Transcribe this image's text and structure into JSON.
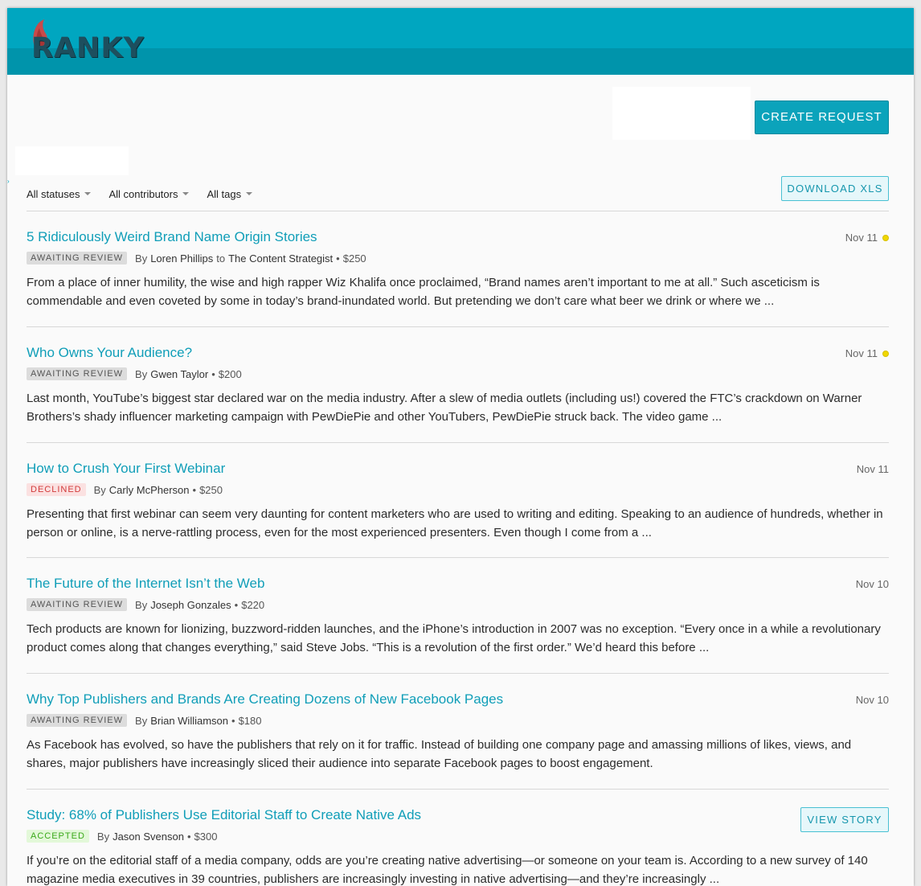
{
  "app": {
    "name": "RANKY",
    "colors": {
      "accent": "#00a6c0",
      "title_link": "#109eb8",
      "pending_dot": "#f0d700"
    }
  },
  "toolbar": {
    "create_label": "CREATE REQUEST",
    "download_label": "DOWNLOAD XLS"
  },
  "filters": [
    {
      "label": "All statuses",
      "icon": "chevron-down-icon"
    },
    {
      "label": "All contributors",
      "icon": "chevron-down-icon"
    },
    {
      "label": "All tags",
      "icon": "chevron-down-icon"
    }
  ],
  "requests": [
    {
      "title": "5 Ridiculously Weird Brand Name Origin Stories",
      "status": "AWAITING REVIEW",
      "by": "By",
      "author": "Loren Phillips",
      "to": "to",
      "client": "The Content Strategist",
      "price": "$250",
      "date": "Nov 11",
      "pending": true,
      "excerpt": "From a place of inner humility, the wise and high rapper Wiz Khalifa once proclaimed, “Brand names aren’t important to me at all.” Such asceticism is commendable and even coveted by some in today’s brand-inundated world. But pretending we don’t care what beer we drink or where we ..."
    },
    {
      "title": "Who Owns Your Audience?",
      "status": "AWAITING REVIEW",
      "by": "By",
      "author": "Gwen Taylor",
      "price": "$200",
      "date": "Nov 11",
      "pending": true,
      "excerpt": "Last month, YouTube’s biggest star declared war on the media industry. After a slew of media outlets (including us!) covered the FTC’s crackdown on Warner Brothers’s shady influencer marketing campaign with PewDiePie and other YouTubers, PewDiePie struck back. The video game ..."
    },
    {
      "title": "How to Crush Your First Webinar",
      "status": "DECLINED",
      "by": "By",
      "author": "Carly McPherson",
      "price": "$250",
      "date": "Nov 11",
      "pending": false,
      "excerpt": "Presenting that first webinar can seem very daunting for content marketers who are used to writing and editing. Speaking to an audience of hundreds, whether in person or online, is a nerve-rattling process, even for the most experienced presenters. Even though I come from a ..."
    },
    {
      "title": "The Future of the Internet Isn’t the Web",
      "status": "AWAITING REVIEW",
      "by": "By",
      "author": "Joseph Gonzales",
      "price": "$220",
      "date": "Nov 10",
      "pending": false,
      "excerpt": "Tech products are known for lionizing, buzzword-ridden launches, and the iPhone’s introduction in 2007 was no exception. “Every once in a while a revolutionary product comes along that changes everything,” said Steve Jobs. “This is a revolution of the first order.” We’d heard this before ..."
    },
    {
      "title": "Why Top Publishers and Brands Are Creating Dozens of New Facebook Pages",
      "status": "AWAITING REVIEW",
      "by": "By",
      "author": "Brian Williamson",
      "price": "$180",
      "date": "Nov 10",
      "pending": false,
      "excerpt": "As Facebook has evolved, so have the publishers that rely on it for traffic. Instead of building one company page and amassing millions of likes, views, and shares, major publishers have increasingly sliced their audience into separate Facebook pages to boost engagement."
    },
    {
      "title": "Study: 68% of Publishers Use Editorial Staff to Create Native Ads",
      "status": "ACCEPTED",
      "by": "By",
      "author": "Jason Svenson",
      "price": "$300",
      "action_label": "VIEW STORY",
      "excerpt": "If you’re on the editorial staff of a media company, odds are you’re creating native advertising—or someone on your team is. According to a new survey of 140 magazine media executives in 39 countries, publishers are increasingly investing in native advertising—and they’re increasingly ..."
    }
  ]
}
